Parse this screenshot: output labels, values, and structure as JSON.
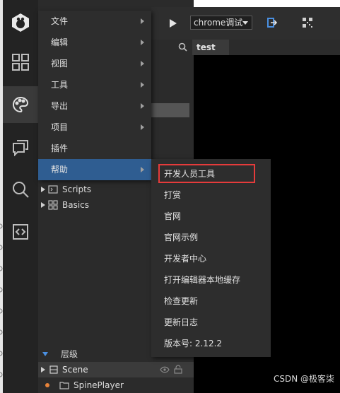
{
  "menu": {
    "items": [
      {
        "label": "文件",
        "has_submenu": true
      },
      {
        "label": "编辑",
        "has_submenu": true
      },
      {
        "label": "视图",
        "has_submenu": true
      },
      {
        "label": "工具",
        "has_submenu": true
      },
      {
        "label": "导出",
        "has_submenu": true
      },
      {
        "label": "项目",
        "has_submenu": true
      },
      {
        "label": "插件",
        "has_submenu": false
      },
      {
        "label": "帮助",
        "has_submenu": true,
        "active": true
      }
    ]
  },
  "submenu": {
    "items": [
      {
        "label": "开发人员工具",
        "highlighted": true
      },
      {
        "label": "打赏"
      },
      {
        "label": "官网"
      },
      {
        "label": "官网示例"
      },
      {
        "label": "开发者中心"
      },
      {
        "label": "打开编辑器本地缓存"
      },
      {
        "label": "检查更新"
      },
      {
        "label": "更新日志"
      },
      {
        "label": "版本号: 2.12.2"
      }
    ]
  },
  "toolbar": {
    "run_mode": "chrome调试"
  },
  "tabs": [
    {
      "label": "test",
      "close": "×"
    }
  ],
  "tree": {
    "items": [
      {
        "label": "Scripts",
        "icon": "script-folder-icon"
      },
      {
        "label": "Basics",
        "icon": "component-icon"
      }
    ]
  },
  "hierarchy": {
    "title": "层级",
    "scene": "Scene",
    "node": "SpinePlayer"
  },
  "rail": {
    "icons": [
      "logo-icon",
      "grid-icon",
      "palette-icon",
      "chat-icon",
      "search-icon",
      "code-icon"
    ]
  },
  "colors": {
    "accent": "#2f5d91",
    "highlight_border": "#e53b3b",
    "rail_bg": "#232323",
    "panel_bg": "#2b2b2b"
  },
  "watermark": "CSDN @极客柒"
}
